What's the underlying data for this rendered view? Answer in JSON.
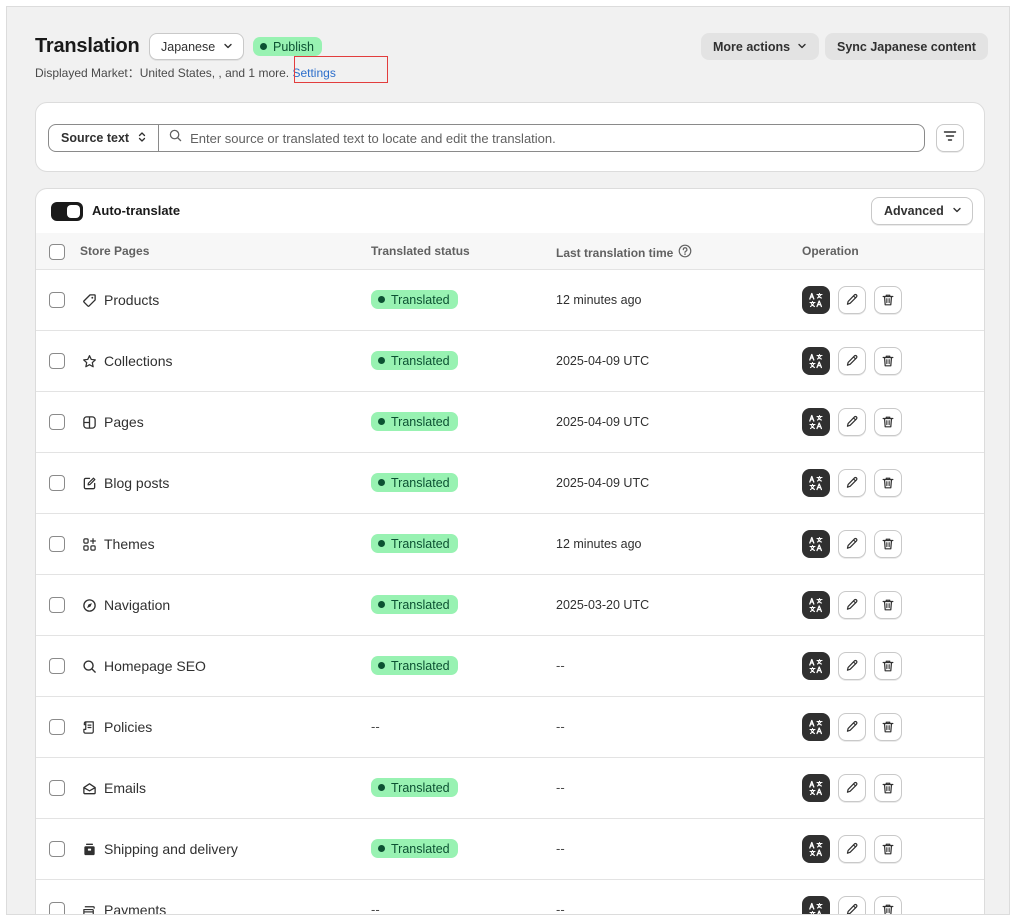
{
  "header": {
    "title": "Translation",
    "language": "Japanese",
    "publish_label": "Publish",
    "market_text": "Displayed Market：United States, , and 1 more. ",
    "settings_link": "Settings",
    "more_actions": "More actions",
    "sync_label": "Sync Japanese content"
  },
  "search": {
    "source_label": "Source text",
    "placeholder": "Enter source or translated text to locate and edit the translation."
  },
  "table": {
    "auto_translate_label": "Auto-translate",
    "auto_translate_on": true,
    "advanced_label": "Advanced",
    "columns": {
      "name": "Store Pages",
      "status": "Translated status",
      "time": "Last translation time",
      "operation": "Operation"
    },
    "rows": [
      {
        "name": "Products",
        "icon": "tag-icon",
        "status": "Translated",
        "time": "12 minutes ago"
      },
      {
        "name": "Collections",
        "icon": "star-icon",
        "status": "Translated",
        "time": "2025-04-09 UTC"
      },
      {
        "name": "Pages",
        "icon": "layout-icon",
        "status": "Translated",
        "time": "2025-04-09 UTC"
      },
      {
        "name": "Blog posts",
        "icon": "compose-icon",
        "status": "Translated",
        "time": "2025-04-09 UTC"
      },
      {
        "name": "Themes",
        "icon": "apps-icon",
        "status": "Translated",
        "time": "12 minutes ago"
      },
      {
        "name": "Navigation",
        "icon": "compass-icon",
        "status": "Translated",
        "time": "2025-03-20 UTC"
      },
      {
        "name": "Homepage SEO",
        "icon": "search-icon",
        "status": "Translated",
        "time": "--"
      },
      {
        "name": "Policies",
        "icon": "policy-icon",
        "status": "--",
        "time": "--"
      },
      {
        "name": "Emails",
        "icon": "email-icon",
        "status": "Translated",
        "time": "--"
      },
      {
        "name": "Shipping and delivery",
        "icon": "package-icon",
        "status": "Translated",
        "time": "--"
      },
      {
        "name": "Payments",
        "icon": "payment-icon",
        "status": "--",
        "time": "--"
      }
    ]
  },
  "colors": {
    "badge_bg": "#98f2b2",
    "badge_text": "#0c5132",
    "link": "#2c6ecb",
    "highlight": "#e23d3d"
  }
}
